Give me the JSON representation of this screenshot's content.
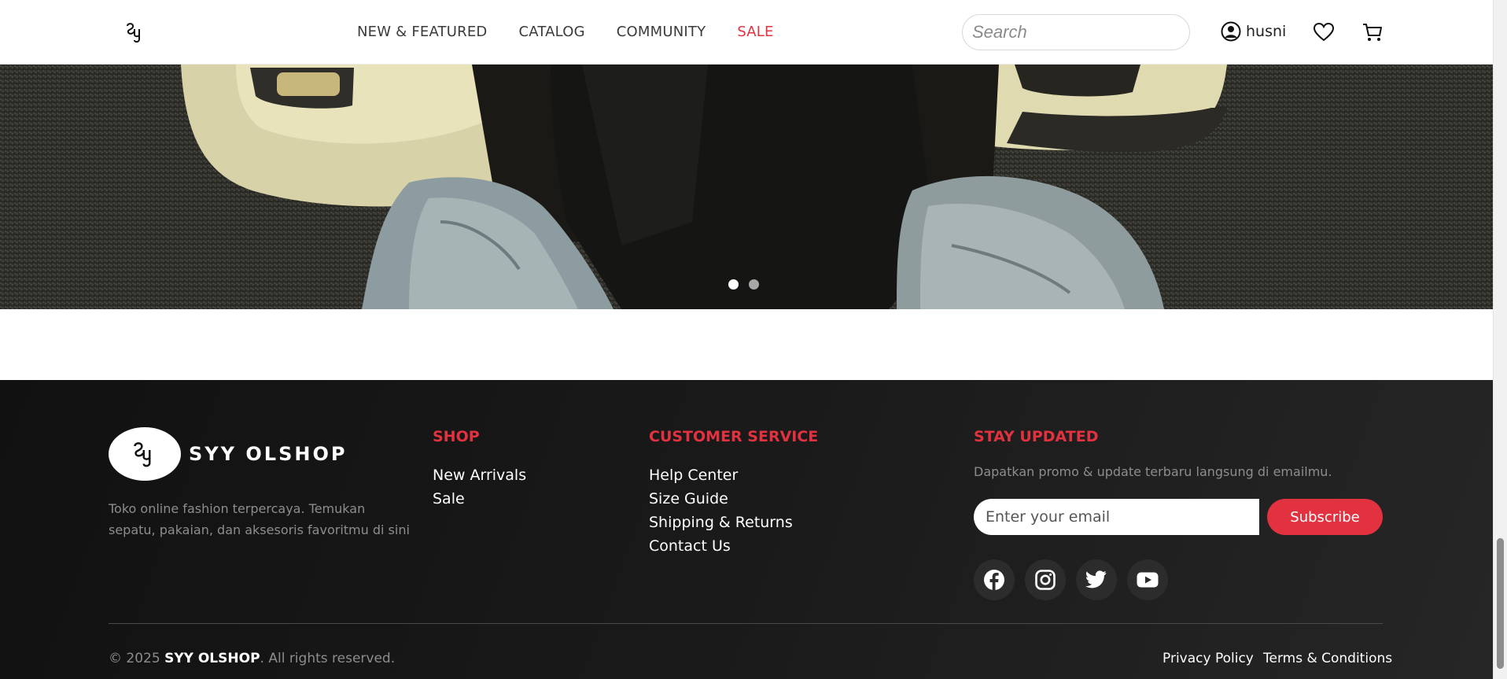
{
  "header": {
    "nav": {
      "new_featured": "NEW & FEATURED",
      "catalog": "CATALOG",
      "community": "COMMUNITY",
      "sale": "SALE"
    },
    "search_placeholder": "Search",
    "username": "husni"
  },
  "hero": {
    "slide_count": 2,
    "active_slide": 1
  },
  "footer": {
    "brand_name": "SYY OLSHOP",
    "brand_description": "Toko online fashion terpercaya. Temukan sepatu, pakaian, dan aksesoris favoritmu di sini",
    "shop": {
      "title": "SHOP",
      "items": [
        "New Arrivals",
        "Sale"
      ]
    },
    "customer_service": {
      "title": "CUSTOMER SERVICE",
      "items": [
        "Help Center",
        "Size Guide",
        "Shipping & Returns",
        "Contact Us"
      ]
    },
    "stay_updated": {
      "title": "STAY UPDATED",
      "description": "Dapatkan promo & update terbaru langsung di emailmu.",
      "email_placeholder": "Enter your email",
      "subscribe_label": "Subscribe"
    },
    "socials": [
      "facebook-icon",
      "instagram-icon",
      "twitter-icon",
      "youtube-icon"
    ],
    "copyright_prefix": "© 2025 ",
    "copyright_brand": "SYY OLSHOP",
    "copyright_suffix": ". All rights reserved.",
    "legal": {
      "privacy": "Privacy Policy",
      "terms": "Terms & Conditions"
    }
  },
  "colors": {
    "accent": "#e23240",
    "footer_bg": "#161616",
    "muted_text": "#8d8d8d"
  }
}
